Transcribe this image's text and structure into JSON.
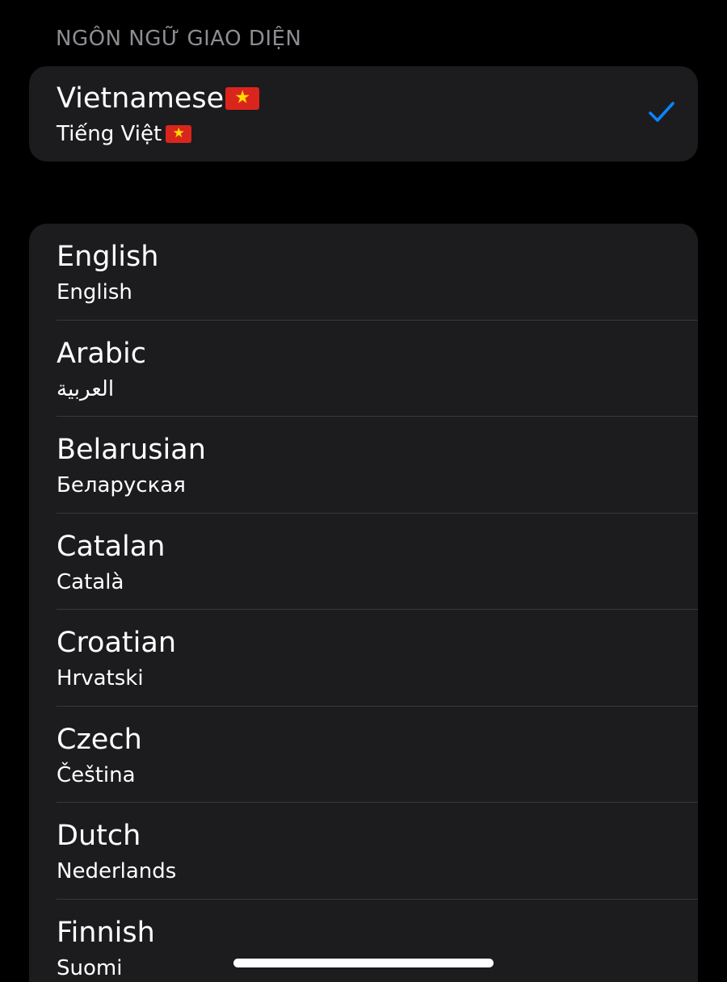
{
  "section_header": "NGÔN NGỮ GIAO DIỆN",
  "current_language": {
    "name": "Vietnamese",
    "native": "Tiếng Việt",
    "flag_icon": "vietnam-flag-icon",
    "flag_star": "★",
    "selected_icon": "checkmark-icon"
  },
  "languages": [
    {
      "name": "English",
      "native": "English"
    },
    {
      "name": "Arabic",
      "native": "العربية"
    },
    {
      "name": "Belarusian",
      "native": "Беларуская"
    },
    {
      "name": "Catalan",
      "native": "Català"
    },
    {
      "name": "Croatian",
      "native": "Hrvatski"
    },
    {
      "name": "Czech",
      "native": "Čeština"
    },
    {
      "name": "Dutch",
      "native": "Nederlands"
    },
    {
      "name": "Finnish",
      "native": "Suomi"
    }
  ],
  "colors": {
    "background": "#000000",
    "card": "#1c1c1e",
    "separator": "#38383a",
    "header_text": "#8d8d92",
    "accent_checkmark": "#0a84ff",
    "flag_red": "#da251d",
    "flag_star_yellow": "#ffdd00"
  }
}
